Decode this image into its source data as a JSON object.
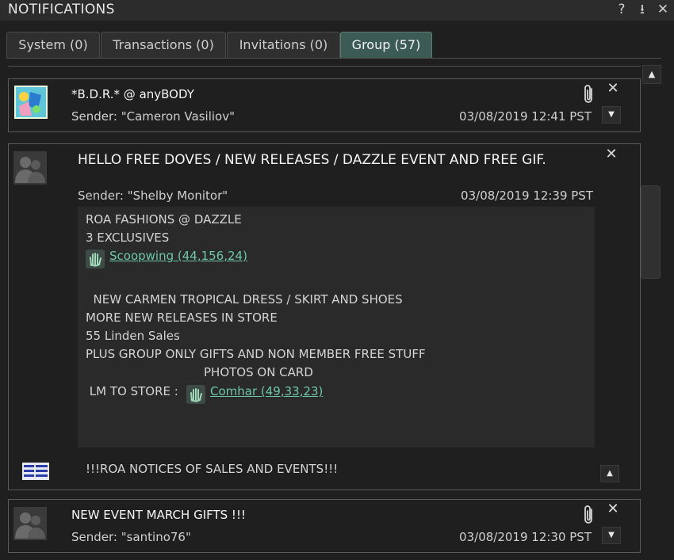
{
  "window": {
    "title": "NOTIFICATIONS",
    "help_icon": "question-icon",
    "help_glyph": "?",
    "dock_icon": "dock-icon",
    "dock_glyph": "⭳",
    "close_icon": "close-icon",
    "close_glyph": "✕"
  },
  "tabs": [
    {
      "label": "System (0)",
      "active": false
    },
    {
      "label": "Transactions (0)",
      "active": false
    },
    {
      "label": "Invitations (0)",
      "active": false
    },
    {
      "label": "Group (57)",
      "active": true
    }
  ],
  "scrollbar": {
    "up_glyph": "▲"
  },
  "colors": {
    "accent": "#3d5b55",
    "link": "#6dc6a7",
    "background": "#1f1f1f"
  },
  "notifications": [
    {
      "subject": "*B.D.R.* @ anyBODY",
      "sender": "Sender: \"Cameron Vasiliov\"",
      "date": "03/08/2019 12:41 PST",
      "close_glyph": "✕",
      "expand_glyph": "▼"
    },
    {
      "subject": "HELLO FREE DOVES / NEW RELEASES / DAZZLE EVENT AND FREE GIF.",
      "sender": "Sender: \"Shelby Monitor\"",
      "date": "03/08/2019 12:39 PST",
      "close_glyph": "✕",
      "collapse_glyph": "▲",
      "message": {
        "line1": "ROA FASHIONS @ DAZZLE",
        "line2": "3 EXCLUSIVES",
        "link1": "Scoopwing (44,156,24)",
        "line4": "  NEW CARMEN TROPICAL DRESS / SKIRT AND SHOES",
        "line5": "MORE NEW RELEASES IN STORE",
        "line6": "55 Linden Sales",
        "line7": "PLUS GROUP ONLY GIFTS AND NON MEMBER FREE STUFF",
        "line8": "PHOTOS ON CARD",
        "line9_prefix": " LM TO STORE :",
        "link2": "Comhar (49,33,23)"
      },
      "group_name": "!!!ROA NOTICES OF SALES AND EVENTS!!!"
    },
    {
      "subject": "NEW EVENT MARCH GIFTS !!!",
      "sender": "Sender: \"santino76\"",
      "date": "03/08/2019 12:30 PST",
      "close_glyph": "✕",
      "expand_glyph": "▼"
    }
  ]
}
